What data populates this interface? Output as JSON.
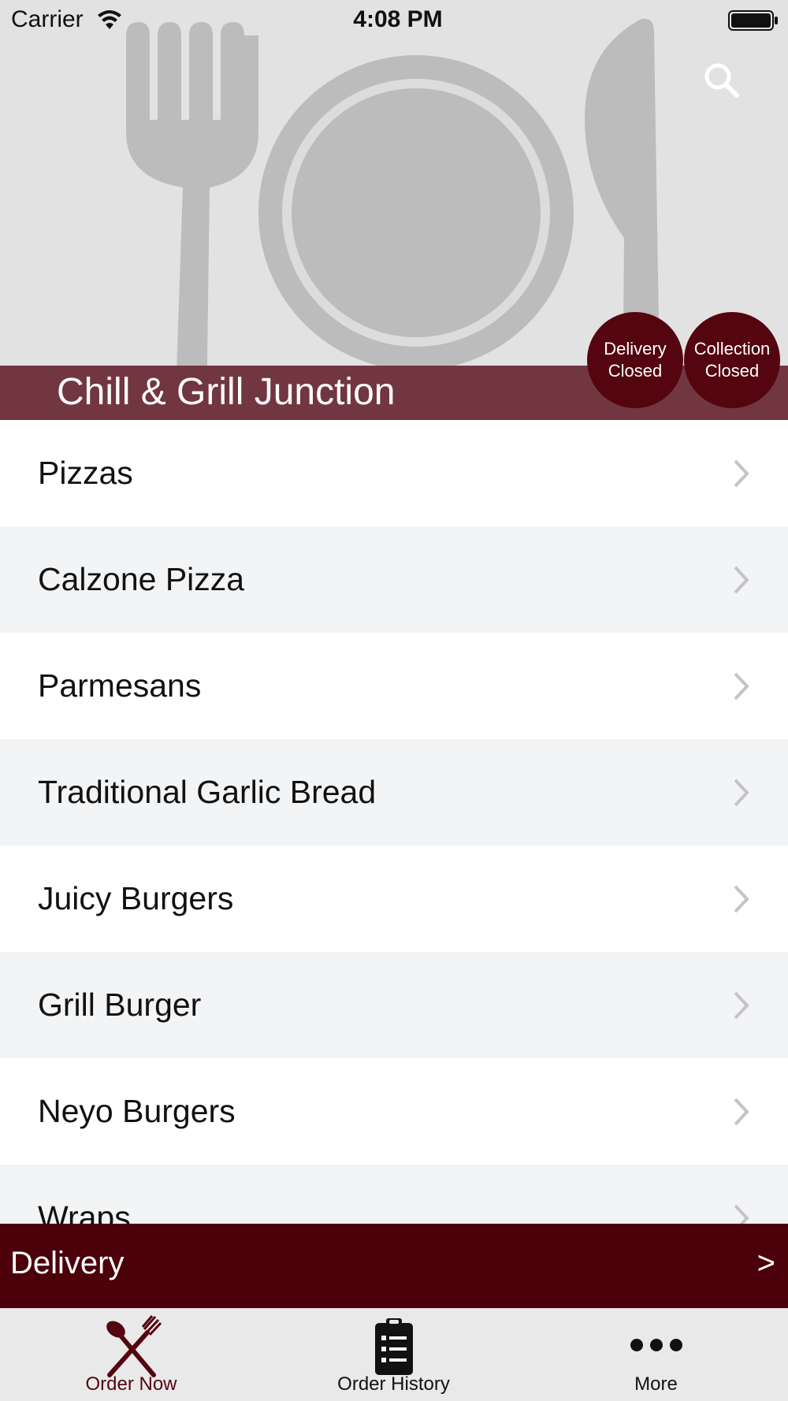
{
  "status_bar": {
    "carrier": "Carrier",
    "time": "4:08 PM",
    "wifi_icon": "wifi-icon",
    "battery_icon": "battery-icon"
  },
  "header": {
    "restaurant_name": "Chill & Grill Junction",
    "search_icon": "search-icon",
    "background_art": "fork-plate-knife"
  },
  "badges": {
    "delivery": {
      "line1": "Delivery",
      "line2": "Closed"
    },
    "collection": {
      "line1": "Collection",
      "line2": "Closed"
    }
  },
  "categories": [
    {
      "label": "Pizzas"
    },
    {
      "label": "Calzone Pizza"
    },
    {
      "label": "Parmesans"
    },
    {
      "label": "Traditional Garlic Bread"
    },
    {
      "label": "Juicy Burgers"
    },
    {
      "label": "Grill Burger"
    },
    {
      "label": "Neyo Burgers"
    },
    {
      "label": "Wraps"
    }
  ],
  "delivery_bar": {
    "label": "Delivery",
    "arrow": ">"
  },
  "tab_bar": {
    "tabs": [
      {
        "label": "Order Now",
        "icon": "fork-spoon-icon",
        "selected": true
      },
      {
        "label": "Order History",
        "icon": "clipboard-list-icon",
        "selected": false
      },
      {
        "label": "More",
        "icon": "more-dots-icon",
        "selected": false
      }
    ]
  },
  "colors": {
    "brand": "#54050f",
    "title_band": "#71363f",
    "delivery_bar": "#4b000a",
    "hero_background": "#e2e2e2",
    "list_alt_row": "#f3f4f6",
    "tab_bar": "#e9e9ea"
  }
}
